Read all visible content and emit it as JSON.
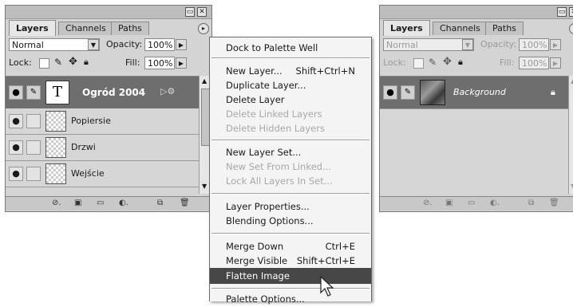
{
  "left_panel": {
    "tabs": [
      "Layers",
      "Channels",
      "Paths"
    ],
    "blend_mode": "Normal",
    "opacity_label": "Opacity:",
    "opacity_value": "100%",
    "lock_label": "Lock:",
    "fill_label": "Fill:",
    "fill_value": "100%",
    "layers": [
      {
        "name": "Ogród 2004",
        "type": "text",
        "selected": true
      },
      {
        "name": "Popiersie",
        "type": "image"
      },
      {
        "name": "Drzwi",
        "type": "image"
      },
      {
        "name": "Wejście",
        "type": "image"
      }
    ],
    "text_layer_thumb": "T"
  },
  "context_menu": {
    "items": [
      {
        "label": "Dock to Palette Well",
        "enabled": true
      },
      {
        "label": "New Layer...",
        "shortcut": "Shift+Ctrl+N",
        "enabled": true
      },
      {
        "label": "Duplicate Layer...",
        "enabled": true
      },
      {
        "label": "Delete Layer",
        "enabled": true
      },
      {
        "label": "Delete Linked Layers",
        "enabled": false
      },
      {
        "label": "Delete Hidden Layers",
        "enabled": false
      },
      {
        "label": "New Layer Set...",
        "enabled": true
      },
      {
        "label": "New Set From Linked...",
        "enabled": false
      },
      {
        "label": "Lock All Layers In Set...",
        "enabled": false
      },
      {
        "label": "Layer Properties...",
        "enabled": true
      },
      {
        "label": "Blending Options...",
        "enabled": true
      },
      {
        "label": "Merge Down",
        "shortcut": "Ctrl+E",
        "enabled": true
      },
      {
        "label": "Merge Visible",
        "shortcut": "Shift+Ctrl+E",
        "enabled": true
      },
      {
        "label": "Flatten Image",
        "enabled": true,
        "highlighted": true
      },
      {
        "label": "Palette Options...",
        "enabled": true
      }
    ]
  },
  "right_panel": {
    "tabs": [
      "Layers",
      "Channels",
      "Paths"
    ],
    "blend_mode": "Normal",
    "opacity_label": "Opacity:",
    "opacity_value": "100%",
    "lock_label": "Lock:",
    "fill_label": "Fill:",
    "fill_value": "100%",
    "layers": [
      {
        "name": "Background",
        "type": "image",
        "selected": true,
        "locked": true
      }
    ]
  },
  "colors": {
    "panel_bg": "#d4d4d4",
    "selected_layer": "#6e6e6e",
    "menu_highlight": "#474747",
    "disabled_text": "#a8a8a8"
  }
}
